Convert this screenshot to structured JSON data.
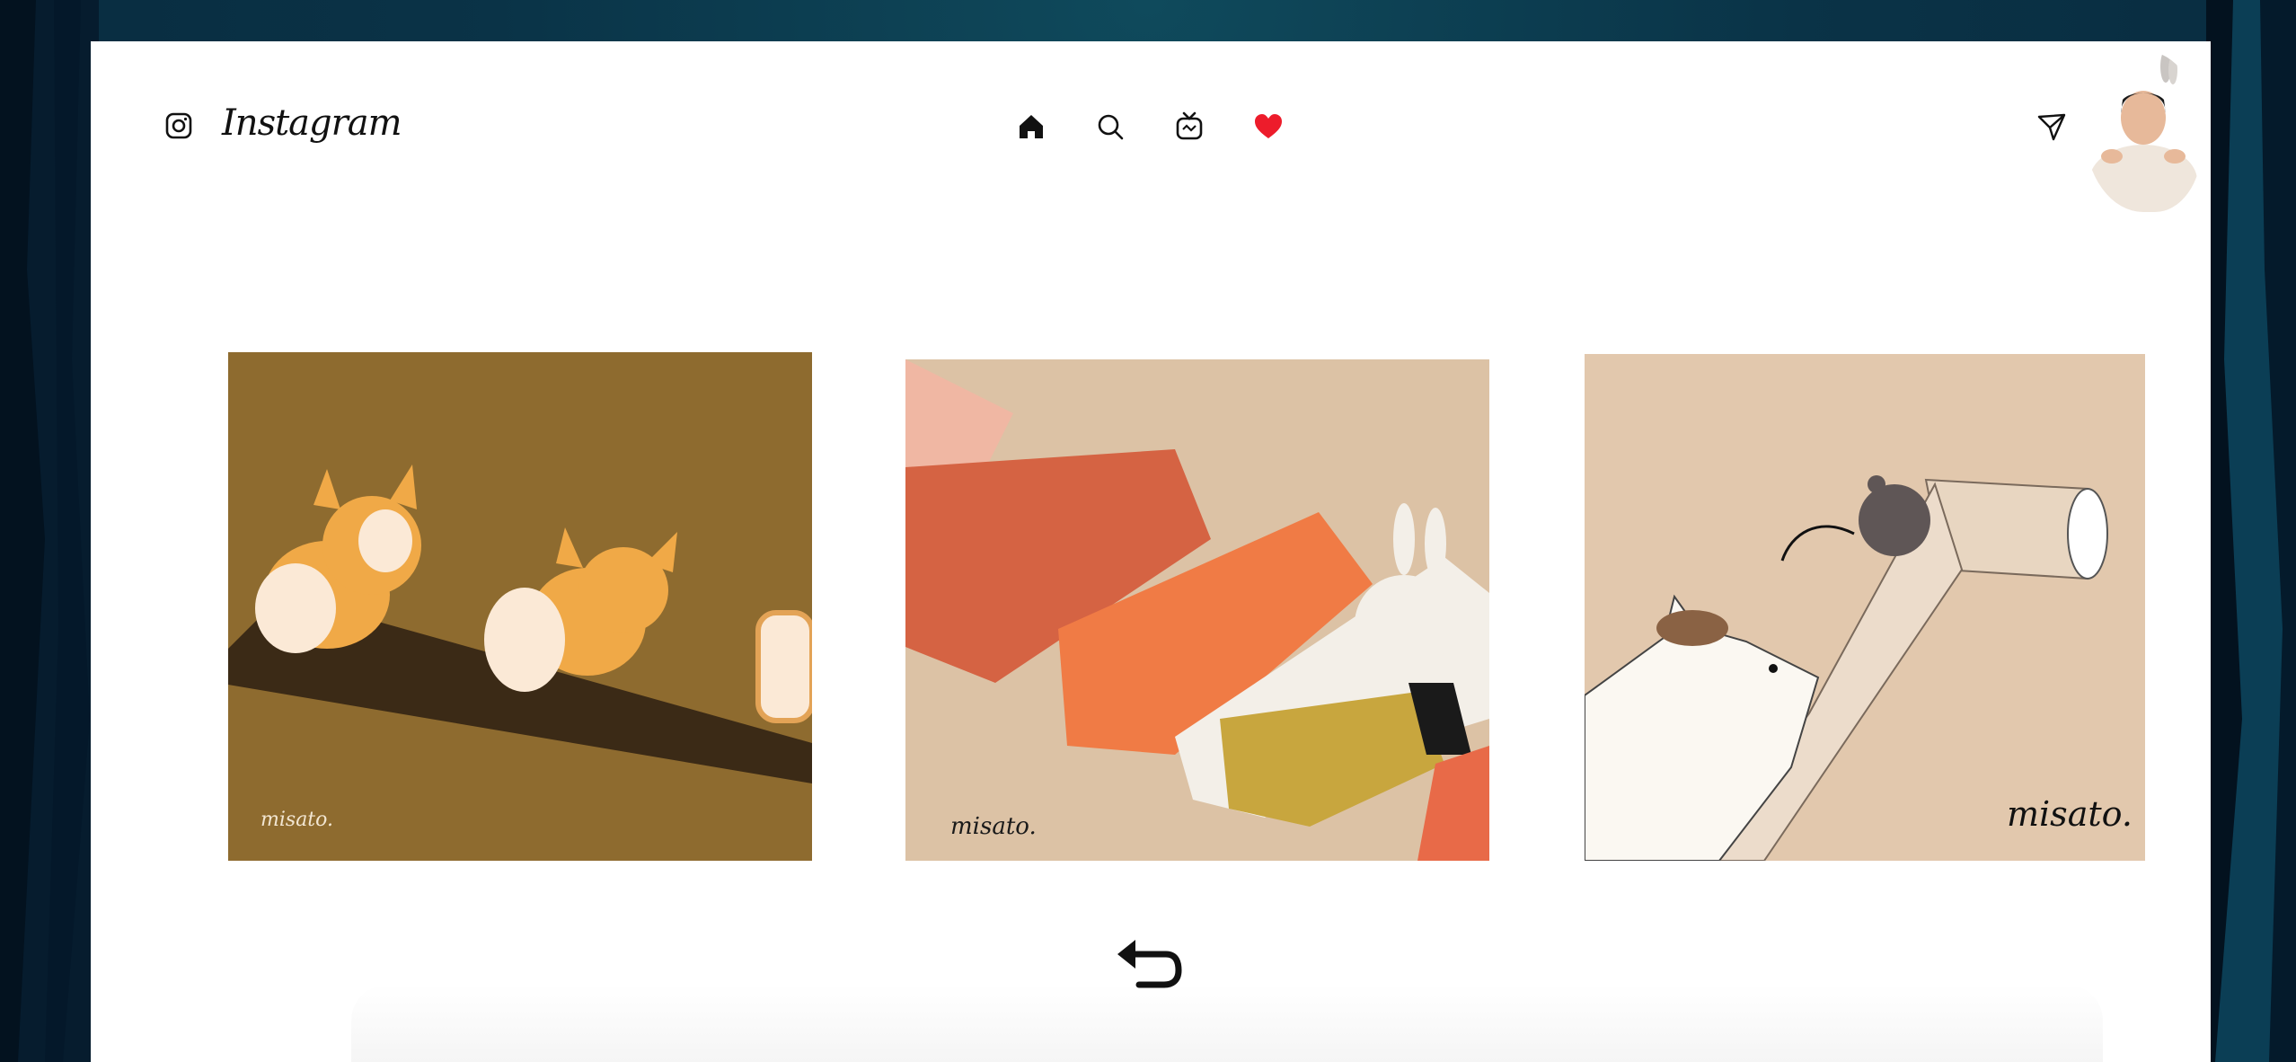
{
  "app": {
    "brand_name": "Instagram",
    "accent_like": "#ed1c2b"
  },
  "nav": {
    "icons": [
      "home-icon",
      "search-icon",
      "igtv-icon",
      "heart-icon",
      "direct-message-icon"
    ]
  },
  "posts": [
    {
      "signature": "misato.",
      "subject": "corgis-bread",
      "bg": "#8c6a2e"
    },
    {
      "signature": "misato.",
      "subject": "sushi-rabbit",
      "bg": "#dcc2a6"
    },
    {
      "signature": "misato.",
      "subject": "cat-mouse-toilet-paper",
      "bg": "#e2c8ad"
    }
  ]
}
